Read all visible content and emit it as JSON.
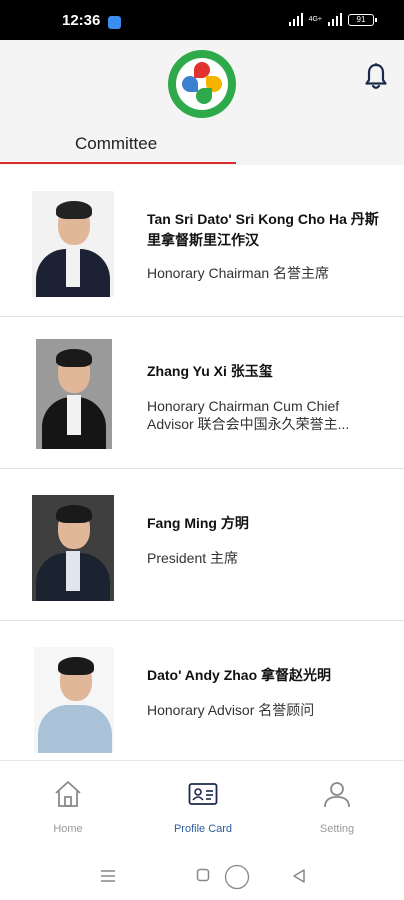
{
  "status_bar": {
    "time": "12:36",
    "network": "4G+",
    "battery": "91"
  },
  "header": {
    "tab_label": "Committee"
  },
  "committee": [
    {
      "name": "Tan Sri Dato' Sri Kong Cho Ha 丹斯里拿督斯里江作汉",
      "title": "Honorary Chairman 名誉主席"
    },
    {
      "name": "Zhang Yu Xi 张玉玺",
      "title": "Honorary Chairman Cum Chief Advisor 联合会中国永久荣誉主..."
    },
    {
      "name": "Fang Ming 方明",
      "title": "President 主席"
    },
    {
      "name": "Dato' Andy Zhao 拿督赵光明",
      "title": "Honorary Advisor 名誉顾问"
    }
  ],
  "bottom_nav": [
    {
      "label": "Home",
      "icon": "home-icon"
    },
    {
      "label": "Profile Card",
      "icon": "profile-card-icon"
    },
    {
      "label": "Setting",
      "icon": "user-icon"
    }
  ],
  "colors": {
    "accent_red": "#d62e2e",
    "active_blue": "#2e5c9e",
    "logo_green": "#2eaa4a"
  }
}
